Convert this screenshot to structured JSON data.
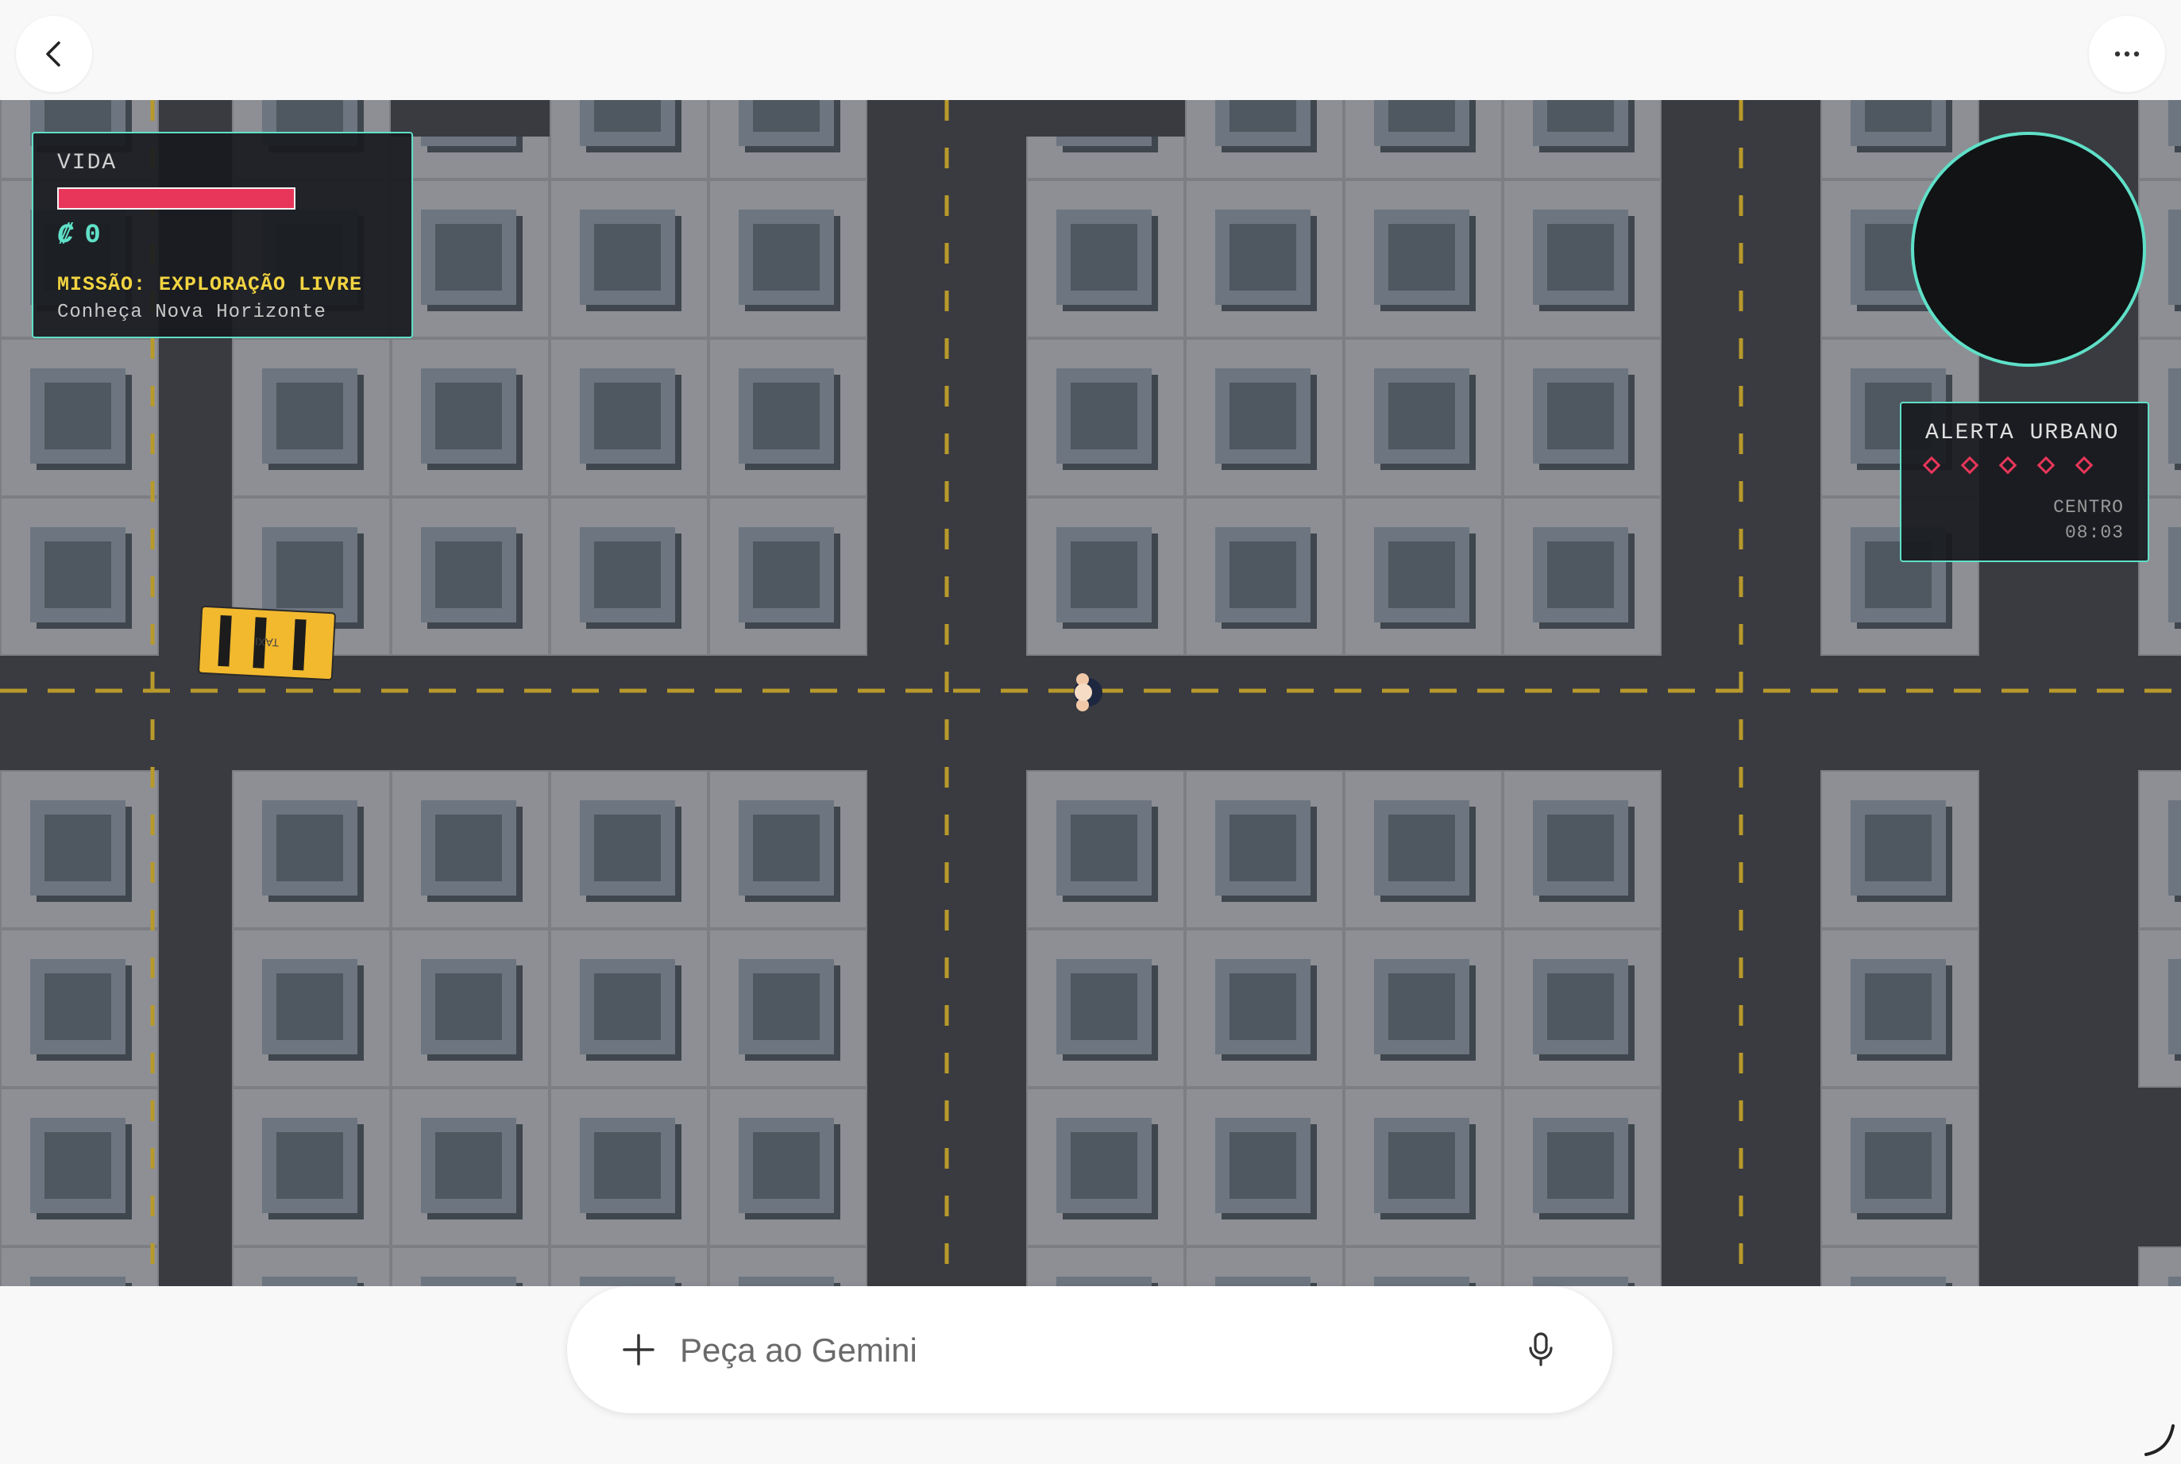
{
  "topbar": {
    "back_icon": "chevron-left-icon",
    "more_icon": "more-horizontal-icon"
  },
  "hud": {
    "life_label": "VIDA",
    "life_level": 1.0,
    "money_symbol": "₡",
    "money_value": "0",
    "mission_title": "MISSÃO: EXPLORAÇÃO LIVRE",
    "mission_subtitle": "Conheça Nova Horizonte"
  },
  "alert": {
    "title": "ALERTA URBANO",
    "level": 0,
    "max_level": 5,
    "district": "CENTRO",
    "time": "08:03"
  },
  "world": {
    "taxi_label": "TAXI",
    "colors": {
      "road": "#3a3b40",
      "lane_marking": "#b89a2c",
      "block": "#8a8c91",
      "building_top": "#4f5860",
      "taxi": "#f2b92e",
      "hud_accent": "#5fe0c8",
      "alert_red": "#e8365a"
    }
  },
  "prompt": {
    "placeholder": "Peça ao Gemini",
    "plus_icon": "plus-icon",
    "mic_icon": "microphone-icon"
  }
}
